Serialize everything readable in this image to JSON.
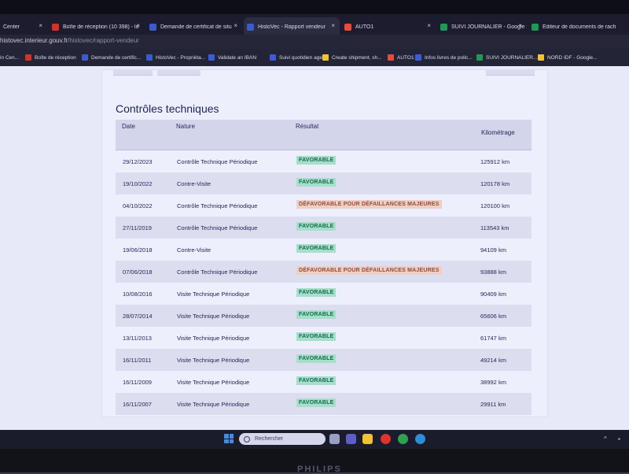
{
  "browser": {
    "tabs": [
      {
        "label": "Center",
        "icon_color": "#1c1c2e",
        "active": false
      },
      {
        "label": "Boîte de réception (10 398) - lo",
        "icon_color": "#d93025",
        "active": false
      },
      {
        "label": "Demande de certificat de situ",
        "icon_color": "#3b5bcc",
        "active": false
      },
      {
        "label": "HistoVec - Rapport vendeur",
        "icon_color": "#3b5bcc",
        "active": true
      },
      {
        "label": "AUTO1",
        "icon_color": "#e84a3c",
        "active": false
      },
      {
        "label": "SUIVI JOURNALIER - Google S",
        "icon_color": "#1e9a55",
        "active": false
      },
      {
        "label": "Éditeur de documents de rach",
        "icon_color": "#1e9a55",
        "active": false
      }
    ],
    "close_glyph": "×",
    "url_host": "histovec.interieur.gouv.fr",
    "url_path": "/histovec/rapport-vendeur",
    "bookmarks": [
      {
        "label": "in Cen...",
        "icon_color": "#1c1c2e"
      },
      {
        "label": "Boîte de réception",
        "icon_color": "#d93025"
      },
      {
        "label": "Demande de certific...",
        "icon_color": "#3b5bcc"
      },
      {
        "label": "HistoVec - Propriéta...",
        "icon_color": "#3b5bcc"
      },
      {
        "label": "Validate an IBAN",
        "icon_color": "#3c5ae0"
      },
      {
        "label": "Suivi quotidien age...",
        "icon_color": "#3c5ae0"
      },
      {
        "label": "Create shipment, sh...",
        "icon_color": "#f2c230"
      },
      {
        "label": "AUTO1",
        "icon_color": "#e84a3c"
      },
      {
        "label": "Infos livres de polic...",
        "icon_color": "#3c5ae0"
      },
      {
        "label": "SUIVI JOURNALIER...",
        "icon_color": "#1e9a55"
      },
      {
        "label": "NORD IDF - Google...",
        "icon_color": "#f2c230"
      }
    ]
  },
  "section": {
    "title": "Contrôles techniques"
  },
  "table": {
    "headers": {
      "date": "Date",
      "nature": "Nature",
      "result": "Résultat",
      "mileage": "Kilométrage"
    },
    "rows": [
      {
        "date": "29/12/2023",
        "nature": "Contrôle Technique Périodique",
        "result": "FAVORABLE",
        "status": "fav",
        "km": "125912 km"
      },
      {
        "date": "19/10/2022",
        "nature": "Contre-Visite",
        "result": "FAVORABLE",
        "status": "fav",
        "km": "120178 km"
      },
      {
        "date": "04/10/2022",
        "nature": "Contrôle Technique Périodique",
        "result": "DÉFAVORABLE POUR DÉFAILLANCES MAJEURES",
        "status": "def",
        "km": "120100 km"
      },
      {
        "date": "27/11/2019",
        "nature": "Contrôle Technique Périodique",
        "result": "FAVORABLE",
        "status": "fav",
        "km": "113543 km"
      },
      {
        "date": "19/06/2018",
        "nature": "Contre-Visite",
        "result": "FAVORABLE",
        "status": "fav",
        "km": "94109 km"
      },
      {
        "date": "07/06/2018",
        "nature": "Contrôle Technique Périodique",
        "result": "DÉFAVORABLE POUR DÉFAILLANCES MAJEURES",
        "status": "def",
        "km": "93888 km"
      },
      {
        "date": "10/08/2016",
        "nature": "Visite Technique Périodique",
        "result": "FAVORABLE",
        "status": "fav",
        "km": "90409 km"
      },
      {
        "date": "28/07/2014",
        "nature": "Visite Technique Périodique",
        "result": "FAVORABLE",
        "status": "fav",
        "km": "65606 km"
      },
      {
        "date": "13/11/2013",
        "nature": "Visite Technique Périodique",
        "result": "FAVORABLE",
        "status": "fav",
        "km": "61747 km"
      },
      {
        "date": "16/11/2011",
        "nature": "Visite Technique Périodique",
        "result": "FAVORABLE",
        "status": "fav",
        "km": "49214 km"
      },
      {
        "date": "16/11/2009",
        "nature": "Visite Technique Périodique",
        "result": "FAVORABLE",
        "status": "fav",
        "km": "38992 km"
      },
      {
        "date": "16/11/2007",
        "nature": "Visite Technique Périodique",
        "result": "FAVORABLE",
        "status": "fav",
        "km": "29911 km"
      }
    ]
  },
  "taskbar": {
    "search_placeholder": "Rechercher",
    "apps": [
      {
        "name": "task-view-icon",
        "color": "#9aa0c4"
      },
      {
        "name": "teams-icon",
        "color": "#5b5fc7"
      },
      {
        "name": "folder-icon",
        "color": "#f2c230"
      },
      {
        "name": "opera-icon",
        "color": "#e0322f"
      },
      {
        "name": "chrome-icon",
        "color": "#2fa24f"
      },
      {
        "name": "edge-icon",
        "color": "#2a8fd8"
      }
    ],
    "tray_glyph": "^"
  },
  "monitor": {
    "brand": "PHILIPS"
  }
}
